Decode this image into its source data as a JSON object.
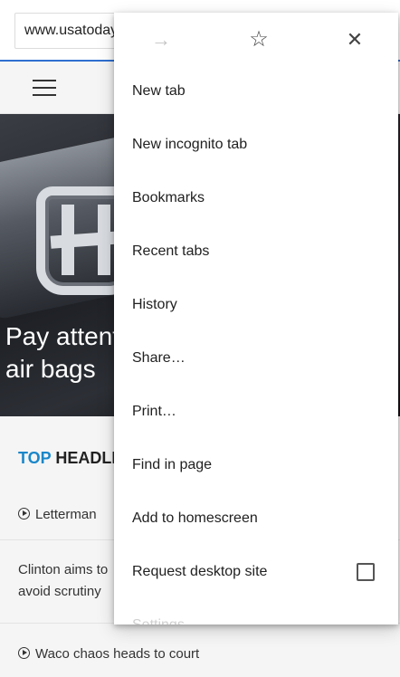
{
  "browser": {
    "url": "www.usatoday.com"
  },
  "article": {
    "hero_caption_line1": "Pay attention to your",
    "hero_caption_line2": "air bags"
  },
  "headlines": {
    "section_accent": "TOP",
    "section_rest": "HEADLINES",
    "items": [
      {
        "text": "Letterman",
        "icon": "play-circle-icon"
      },
      {
        "text": "Clinton aims to avoid scrutiny"
      },
      {
        "text": "Waco chaos heads to court",
        "icon": "play-circle-icon"
      }
    ]
  },
  "menu": {
    "toolbar": {
      "forward_icon": "→",
      "bookmark_icon": "☆",
      "close_icon": "✕"
    },
    "items": [
      {
        "label": "New tab"
      },
      {
        "label": "New incognito tab"
      },
      {
        "label": "Bookmarks"
      },
      {
        "label": "Recent tabs"
      },
      {
        "label": "History"
      },
      {
        "label": "Share…"
      },
      {
        "label": "Print…"
      },
      {
        "label": "Find in page"
      },
      {
        "label": "Add to homescreen"
      },
      {
        "label": "Request desktop site",
        "checked": false
      },
      {
        "label": "Settings"
      }
    ]
  },
  "colors": {
    "address_underline": "#2f6fd0",
    "headline_accent": "#1a87c9"
  }
}
